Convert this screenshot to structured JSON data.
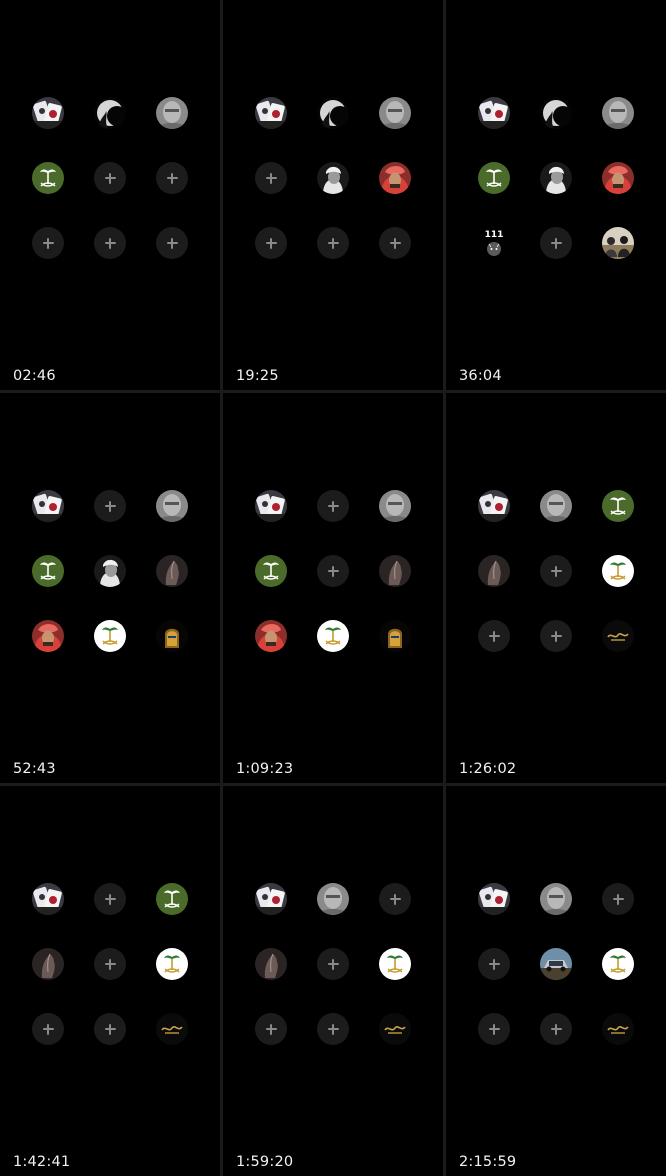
{
  "cells": [
    {
      "time": "02:46",
      "slots": [
        "cards",
        "moon",
        "face_gray",
        "emblem_green",
        "add",
        "add",
        "add",
        "add",
        "add"
      ]
    },
    {
      "time": "19:25",
      "slots": [
        "cards",
        "moon",
        "face_gray",
        "add",
        "face_bw",
        "face_red",
        "add",
        "add",
        "add"
      ]
    },
    {
      "time": "36:04",
      "slots": [
        "cards",
        "moon",
        "face_gray",
        "emblem_green",
        "face_bw",
        "face_red",
        "tiger_111",
        "add",
        "people_gold"
      ]
    },
    {
      "time": "52:43",
      "slots": [
        "cards",
        "add",
        "face_gray",
        "emblem_green",
        "face_bw",
        "horse",
        "face_red",
        "emblem_white",
        "pharaoh"
      ]
    },
    {
      "time": "1:09:23",
      "slots": [
        "cards",
        "add",
        "face_gray",
        "emblem_green",
        "add",
        "horse",
        "face_red",
        "emblem_white",
        "pharaoh"
      ]
    },
    {
      "time": "1:26:02",
      "slots": [
        "cards",
        "face_gray",
        "emblem_green",
        "horse",
        "add",
        "emblem_white",
        "add",
        "add",
        "logo_gold"
      ]
    },
    {
      "time": "1:42:41",
      "slots": [
        "cards",
        "add",
        "emblem_green",
        "horse",
        "add",
        "emblem_white",
        "add",
        "add",
        "logo_gold"
      ]
    },
    {
      "time": "1:59:20",
      "slots": [
        "cards",
        "face_gray",
        "add",
        "horse",
        "add",
        "emblem_white",
        "add",
        "add",
        "logo_gold"
      ]
    },
    {
      "time": "2:15:59",
      "slots": [
        "cards",
        "face_gray",
        "add",
        "add",
        "car_photo",
        "emblem_white",
        "add",
        "add",
        "logo_gold"
      ]
    }
  ],
  "glyph_111": "111",
  "icons": {
    "add": "add-contact-icon",
    "cards": "playing-cards-avatar",
    "moon": "crescent-silhouette-avatar",
    "face_gray": "gray-portrait-avatar",
    "face_bw": "bw-portrait-avatar",
    "face_red": "red-headdress-portrait-avatar",
    "emblem_green": "green-palm-swords-emblem-avatar",
    "emblem_white": "white-palm-swords-emblem-avatar",
    "horse": "dark-horse-avatar",
    "pharaoh": "gold-mask-avatar",
    "tiger_111": "tiger-111-avatar",
    "people_gold": "group-photo-avatar",
    "logo_gold": "gold-script-logo-avatar",
    "car_photo": "car-photo-avatar"
  },
  "colors": {
    "background": "#000000",
    "add_slot": "#1c1c1c",
    "plus": "#8a8a8a",
    "timestamp": "#f2f2f2",
    "emblem_green": "#4a6b2a"
  }
}
